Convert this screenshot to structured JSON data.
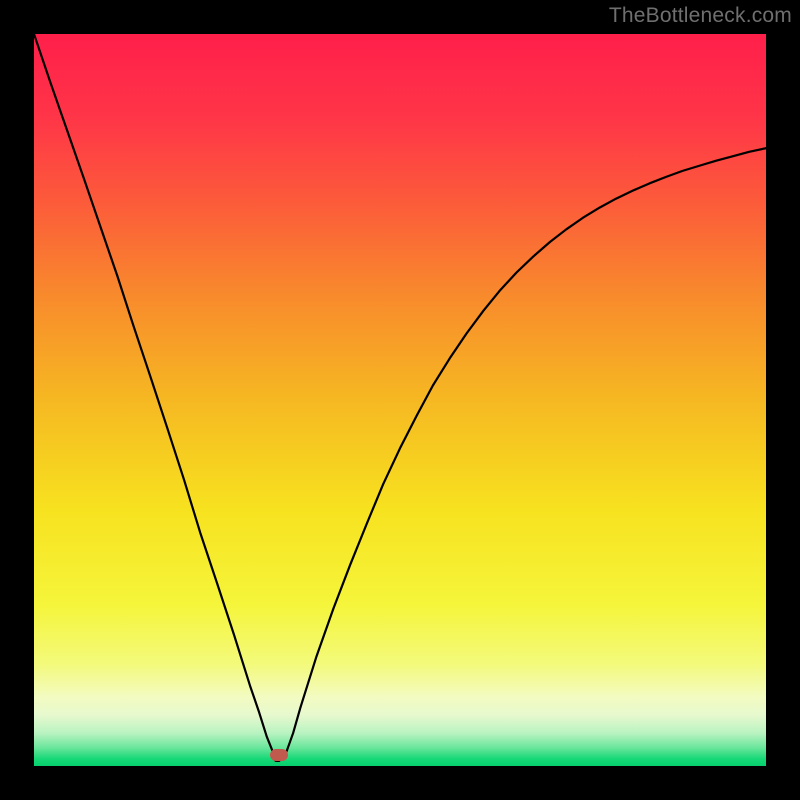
{
  "watermark": "TheBottleneck.com",
  "marker": {
    "x_frac": 0.335,
    "y_frac": 0.985,
    "color": "#c15a4e"
  },
  "chart_data": {
    "type": "line",
    "title": "",
    "xlabel": "",
    "ylabel": "",
    "xlim": [
      0,
      100
    ],
    "ylim": [
      0,
      100
    ],
    "grid": false,
    "legend": false,
    "background": {
      "type": "vertical-gradient",
      "stops": [
        {
          "pos": 0.0,
          "color": "#ff1f4a"
        },
        {
          "pos": 0.11,
          "color": "#ff3448"
        },
        {
          "pos": 0.23,
          "color": "#fc5b3a"
        },
        {
          "pos": 0.36,
          "color": "#f88b2c"
        },
        {
          "pos": 0.5,
          "color": "#f6b822"
        },
        {
          "pos": 0.65,
          "color": "#f7e21f"
        },
        {
          "pos": 0.78,
          "color": "#f5f53b"
        },
        {
          "pos": 0.86,
          "color": "#f3fa7a"
        },
        {
          "pos": 0.905,
          "color": "#f3fbc0"
        },
        {
          "pos": 0.93,
          "color": "#e7f9ce"
        },
        {
          "pos": 0.955,
          "color": "#b9f3c1"
        },
        {
          "pos": 0.975,
          "color": "#6ae69b"
        },
        {
          "pos": 0.99,
          "color": "#17d877"
        },
        {
          "pos": 1.0,
          "color": "#07d06e"
        }
      ]
    },
    "series": [
      {
        "name": "bottleneck-curve",
        "color": "#000000",
        "x": [
          0.0,
          2.2,
          4.5,
          6.8,
          9.1,
          11.4,
          13.6,
          15.9,
          18.2,
          20.5,
          22.7,
          25.0,
          27.3,
          29.5,
          30.7,
          31.8,
          32.8,
          33.0,
          33.5,
          34.4,
          35.4,
          36.4,
          38.6,
          40.9,
          43.2,
          45.5,
          47.7,
          50.0,
          52.3,
          54.5,
          56.8,
          59.1,
          61.4,
          63.6,
          65.9,
          68.2,
          70.5,
          72.7,
          75.0,
          77.3,
          79.5,
          81.8,
          84.1,
          86.4,
          88.6,
          90.9,
          93.2,
          95.5,
          97.7,
          100.0
        ],
        "y": [
          100.0,
          93.5,
          86.9,
          80.3,
          73.6,
          66.9,
          60.1,
          53.2,
          46.2,
          39.1,
          31.9,
          25.0,
          18.0,
          11.0,
          7.5,
          4.0,
          1.5,
          0.7,
          0.7,
          1.7,
          4.5,
          8.0,
          15.0,
          21.5,
          27.5,
          33.2,
          38.5,
          43.4,
          47.9,
          52.0,
          55.7,
          59.1,
          62.2,
          64.9,
          67.4,
          69.6,
          71.6,
          73.3,
          74.9,
          76.3,
          77.5,
          78.6,
          79.6,
          80.5,
          81.3,
          82.0,
          82.7,
          83.3,
          83.9,
          84.4
        ]
      }
    ],
    "marker_point": {
      "x": 33.5,
      "y": 1.5
    }
  }
}
